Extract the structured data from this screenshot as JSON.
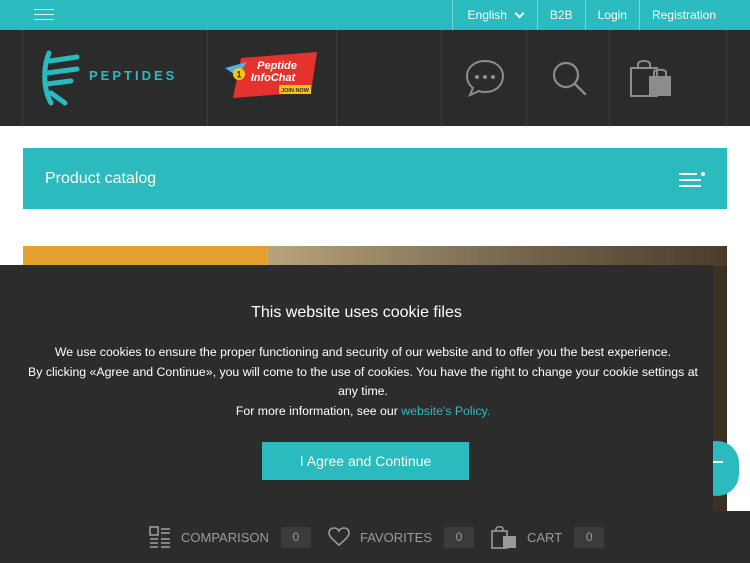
{
  "topbar": {
    "language": "English",
    "b2b": "B2B",
    "login": "Login",
    "registration": "Registration"
  },
  "header": {
    "logo_text": "PEPTIDES",
    "infochat": {
      "line1": "Peptide",
      "line2": "InfoChat",
      "badge": "1",
      "cta": "JOIN NOW"
    }
  },
  "catalog": {
    "title": "Product catalog"
  },
  "cookie": {
    "title": "This website uses cookie files",
    "line1": "We use cookies to ensure the proper functioning and security of our website and to offer you the best experience.",
    "line2": "By clicking «Agree and Continue», you will come to the use of cookies. You have the right to change your cookie settings at any time.",
    "line3_prefix": "For more information, see our ",
    "line3_link": "website's Policy.",
    "button": "I Agree and Continue"
  },
  "bottombar": {
    "comparison": {
      "label": "COMPARISON",
      "count": "0"
    },
    "favorites": {
      "label": "FAVORITES",
      "count": "0"
    },
    "cart": {
      "label": "CART",
      "count": "0"
    }
  },
  "colors": {
    "accent": "#2bbbbf",
    "dark": "#2b2b2b",
    "overlay": "#2c2c2c",
    "infochat_red": "#e5322d"
  },
  "icons": [
    "menu-icon",
    "chevron-down-icon",
    "chat-icon",
    "search-icon",
    "shopping-bag-icon",
    "catalog-menu-icon",
    "compare-icon",
    "heart-icon",
    "cart-icon"
  ]
}
